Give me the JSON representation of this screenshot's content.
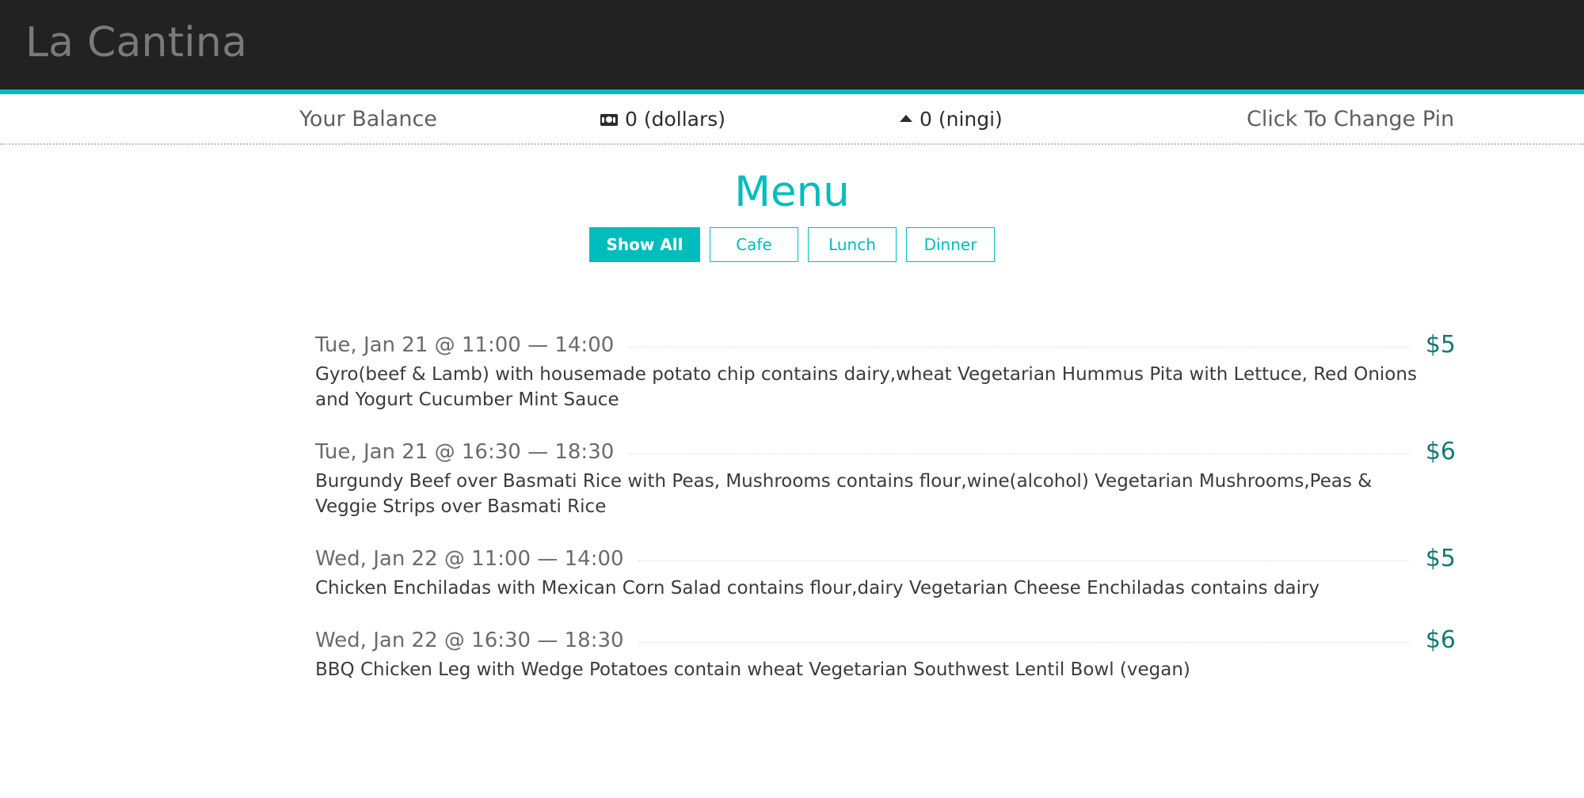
{
  "header": {
    "brand_title": "La Cantina",
    "accent_color": "#00bdbd",
    "background_color": "#222222"
  },
  "balance_bar": {
    "label": "Your Balance",
    "dollars": {
      "icon": "dollar-banknote-icon",
      "amount": "0",
      "unit": "(dollars)",
      "text": "0 (dollars)"
    },
    "ningi": {
      "icon": "triangle-up-icon",
      "amount": "0",
      "unit": "(ningi)",
      "text": "0 (ningi)"
    },
    "change_pin_label": "Click To Change Pin"
  },
  "menu": {
    "title": "Menu",
    "filters": [
      {
        "label": "Show All",
        "active": true
      },
      {
        "label": "Cafe",
        "active": false
      },
      {
        "label": "Lunch",
        "active": false
      },
      {
        "label": "Dinner",
        "active": false
      }
    ],
    "entries": [
      {
        "time": "Tue, Jan 21 @ 11:00 — 14:00",
        "price": "$5",
        "description": "Gyro(beef & Lamb) with housemade potato chip contains dairy,wheat Vegetarian Hummus Pita with Lettuce, Red Onions and Yogurt Cucumber Mint Sauce"
      },
      {
        "time": "Tue, Jan 21 @ 16:30 — 18:30",
        "price": "$6",
        "description": "Burgundy Beef over Basmati Rice with Peas, Mushrooms contains flour,wine(alcohol) Vegetarian Mushrooms,Peas & Veggie Strips over Basmati Rice"
      },
      {
        "time": "Wed, Jan 22 @ 11:00 — 14:00",
        "price": "$5",
        "description": "Chicken Enchiladas with Mexican Corn Salad contains flour,dairy Vegetarian Cheese Enchiladas contains dairy"
      },
      {
        "time": "Wed, Jan 22 @ 16:30 — 18:30",
        "price": "$6",
        "description": "BBQ Chicken Leg with Wedge Potatoes contain wheat Vegetarian Southwest Lentil Bowl (vegan)"
      }
    ]
  },
  "colors": {
    "accent_teal": "#00bdbd",
    "price_teal": "#137a73",
    "header_dark": "#222222",
    "brand_grey": "#7a7a7a"
  }
}
